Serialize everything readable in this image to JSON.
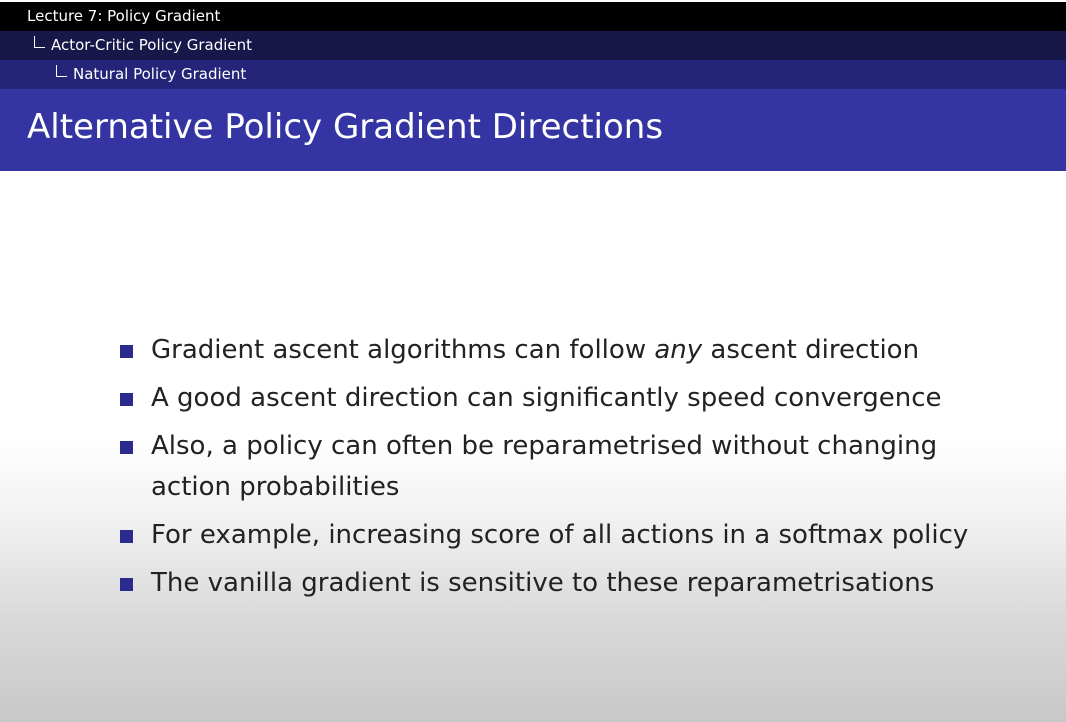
{
  "nav": {
    "lecture": "Lecture 7: Policy Gradient",
    "section": "Actor-Critic Policy Gradient",
    "subsection": "Natural Policy Gradient"
  },
  "slide": {
    "title": "Alternative Policy Gradient Directions",
    "bullets": [
      {
        "before": "Gradient ascent algorithms can follow ",
        "emphasis": "any",
        "after": " ascent direction"
      },
      {
        "text": "A good ascent direction can significantly speed convergence"
      },
      {
        "text": "Also, a policy can often be reparametrised without changing action probabilities"
      },
      {
        "text": "For example, increasing score of all actions in a softmax policy"
      },
      {
        "text": "The vanilla gradient is sensitive to these reparametrisations"
      }
    ]
  },
  "colors": {
    "title_bar": "#3434a2",
    "bullet": "#2b2b8f",
    "nav_top": "#000000",
    "nav_mid": "#17174a",
    "nav_bottom": "#242479"
  }
}
